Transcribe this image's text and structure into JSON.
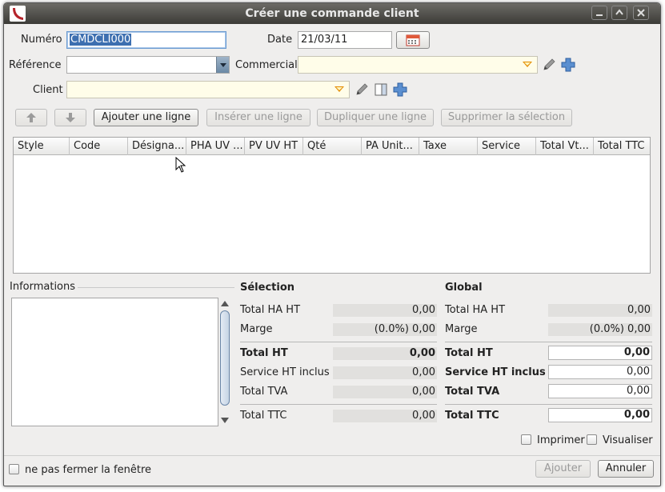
{
  "window": {
    "title": "Créer une commande client"
  },
  "form": {
    "numero_label": "Numéro",
    "numero_value": "CMDCLI000",
    "date_label": "Date",
    "date_value": "21/03/11",
    "reference_label": "Référence",
    "reference_value": "",
    "commercial_label": "Commercial",
    "commercial_value": "",
    "client_label": "Client",
    "client_value": ""
  },
  "toolbar": {
    "add_line": "Ajouter une ligne",
    "insert_line": "Insérer une ligne",
    "duplicate_line": "Dupliquer une ligne",
    "delete_selection": "Supprimer la sélection"
  },
  "table": {
    "columns": [
      "Style",
      "Code",
      "Désigna...",
      "PHA UV ...",
      "PV UV HT",
      "Qté",
      "PA Unit...",
      "Taxe",
      "Service",
      "Total Vt...",
      "Total TTC"
    ]
  },
  "informations": {
    "label": "Informations"
  },
  "selection": {
    "title": "Sélection",
    "rows": [
      {
        "label": "Total HA HT",
        "value": "0,00"
      },
      {
        "label": "Marge",
        "value": "(0.0%) 0,00"
      },
      {
        "label": "Total HT",
        "value": "0,00"
      },
      {
        "label": "Service HT inclus",
        "value": "0,00"
      },
      {
        "label": "Total TVA",
        "value": "0,00"
      },
      {
        "label": "Total TTC",
        "value": "0,00"
      }
    ]
  },
  "global": {
    "title": "Global",
    "rows": [
      {
        "label": "Total HA HT",
        "value": "0,00"
      },
      {
        "label": "Marge",
        "value": "(0.0%) 0,00"
      },
      {
        "label": "Total HT",
        "value": "0,00"
      },
      {
        "label": "Service HT inclus",
        "value": "0,00"
      },
      {
        "label": "Total TVA",
        "value": "0,00"
      },
      {
        "label": "Total TTC",
        "value": "0,00"
      }
    ]
  },
  "options": {
    "imprimer": "Imprimer",
    "visualiser": "Visualiser",
    "keep_open": "ne pas fermer la fenêtre"
  },
  "actions": {
    "ajouter": "Ajouter",
    "annuler": "Annuler"
  },
  "colors": {
    "accent_blue": "#3d6fb0",
    "combo_yellow": "#fffde9",
    "combo_arrow": "#e38b00",
    "titlebar": "#3c3b37"
  }
}
